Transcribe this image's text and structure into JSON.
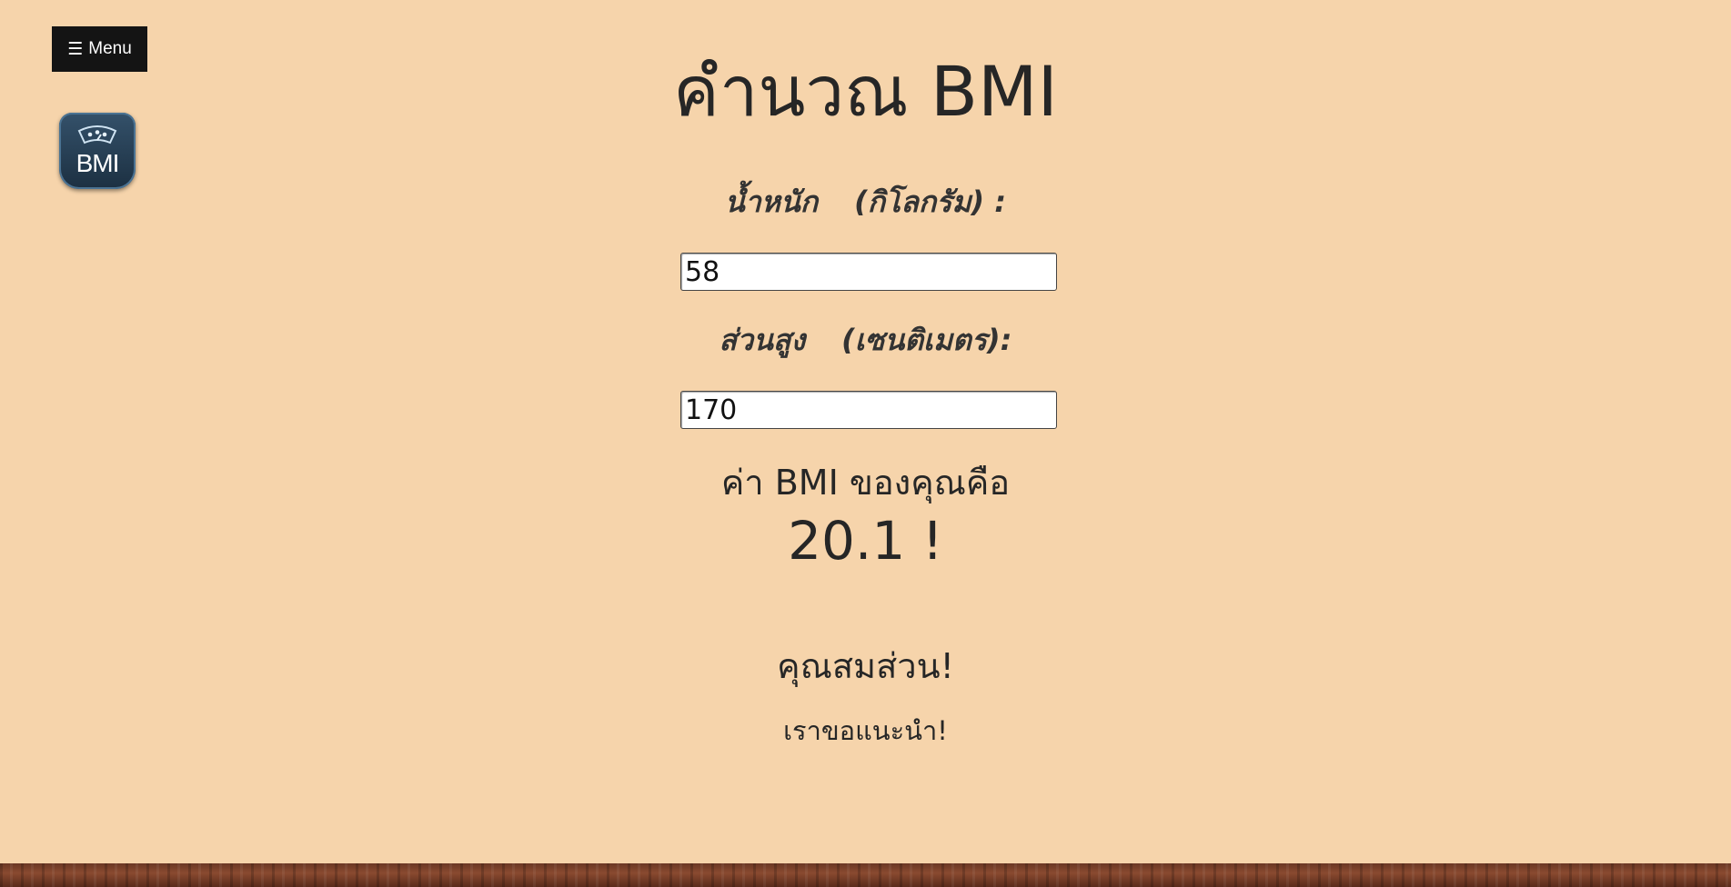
{
  "menu": {
    "icon": "hamburger-icon",
    "glyph": "☰",
    "label": "Menu"
  },
  "logo": {
    "text": "BMI",
    "icon": "scale-icon"
  },
  "page": {
    "title": "คำนวณ BMI"
  },
  "form": {
    "weight_label": "น้ำหนัก",
    "weight_unit": "(กิโลกรัม) :",
    "weight_value": "58",
    "height_label": "ส่วนสูง",
    "height_unit": "(เซนติเมตร):",
    "height_value": "170"
  },
  "result": {
    "label": "ค่า BMI ของคุณคือ",
    "value": "20.1 !",
    "status": "คุณสมส่วน!",
    "advice": "เราขอแนะนำ!"
  },
  "colors": {
    "background": "#f6d4ab",
    "menu_background": "#141414",
    "logo_background": "#1c3042",
    "footer": "#7a3f28"
  }
}
